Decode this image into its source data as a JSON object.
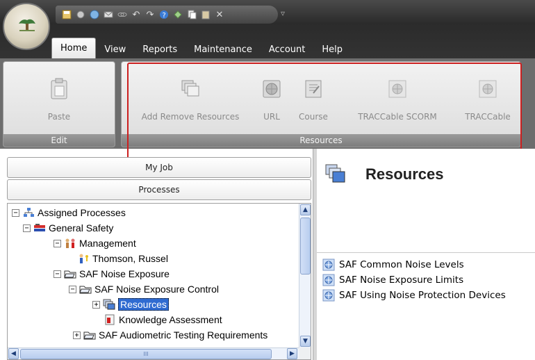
{
  "ribbon_tabs": [
    "Home",
    "View",
    "Reports",
    "Maintenance",
    "Account",
    "Help"
  ],
  "ribbon": {
    "edit_group": {
      "label": "Edit",
      "paste_label": "Paste"
    },
    "resources_group": {
      "label": "Resources",
      "buttons": [
        "Add Remove Resources",
        "URL",
        "Course",
        "TRACCable SCORM",
        "TRACCable"
      ]
    }
  },
  "left_pane": {
    "my_job_label": "My Job",
    "processes_label": "Processes",
    "tree": [
      {
        "label": "Assigned Processes",
        "icon": "hierarchy-icon",
        "expander": "−"
      },
      {
        "label": "General Safety",
        "icon": "group-icon",
        "expander": "−"
      },
      {
        "label": "Management",
        "icon": "people-icon",
        "expander": "−"
      },
      {
        "label": "Thomson, Russel",
        "icon": "user-icon",
        "expander": ""
      },
      {
        "label": "SAF  Noise Exposure",
        "icon": "folder-icon",
        "expander": "−"
      },
      {
        "label": "SAF  Noise Exposure Control",
        "icon": "folder-icon",
        "expander": "−"
      },
      {
        "label": "Resources",
        "icon": "resources-icon",
        "expander": "+"
      },
      {
        "label": "Knowledge Assessment",
        "icon": "assessment-icon",
        "expander": ""
      },
      {
        "label": "SAF  Audiometric Testing Requirements",
        "icon": "folder-icon",
        "expander": "+"
      }
    ],
    "scroll_grip": "III"
  },
  "right_pane": {
    "title": "Resources",
    "items": [
      "SAF  Common Noise Levels",
      "SAF  Noise Exposure Limits",
      "SAF  Using Noise Protection Devices"
    ]
  },
  "colors": {
    "highlight": "#cc1f1f",
    "selection": "#2f6bd1",
    "ribbon_bg": "#6d6d6d"
  }
}
